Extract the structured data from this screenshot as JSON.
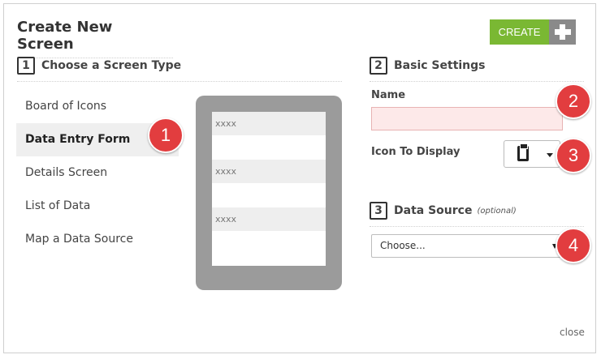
{
  "dialog": {
    "title": "Create New Screen",
    "create_label": "CREATE",
    "close_label": "close"
  },
  "step1": {
    "number": "1",
    "title": "Choose a Screen Type",
    "items": [
      {
        "label": "Board of Icons",
        "selected": false
      },
      {
        "label": "Data Entry Form",
        "selected": true
      },
      {
        "label": "Details Screen",
        "selected": false
      },
      {
        "label": "List of Data",
        "selected": false
      },
      {
        "label": "Map a Data Source",
        "selected": false
      }
    ],
    "preview_rows": [
      "xxxx",
      "xxxx",
      "xxxx"
    ]
  },
  "step2": {
    "number": "2",
    "title": "Basic Settings",
    "name_label": "Name",
    "name_value": "",
    "icon_label": "Icon To Display",
    "icon_name": "clipboard-icon"
  },
  "step3": {
    "number": "3",
    "title": "Data Source",
    "optional": "(optional)",
    "select_value": "Choose..."
  },
  "badges": [
    "1",
    "2",
    "3",
    "4"
  ],
  "colors": {
    "create_green": "#7ab833",
    "badge_red": "#e23d3f",
    "phone_gray": "#9b9b9b",
    "name_field_bg": "#fde9e9"
  }
}
